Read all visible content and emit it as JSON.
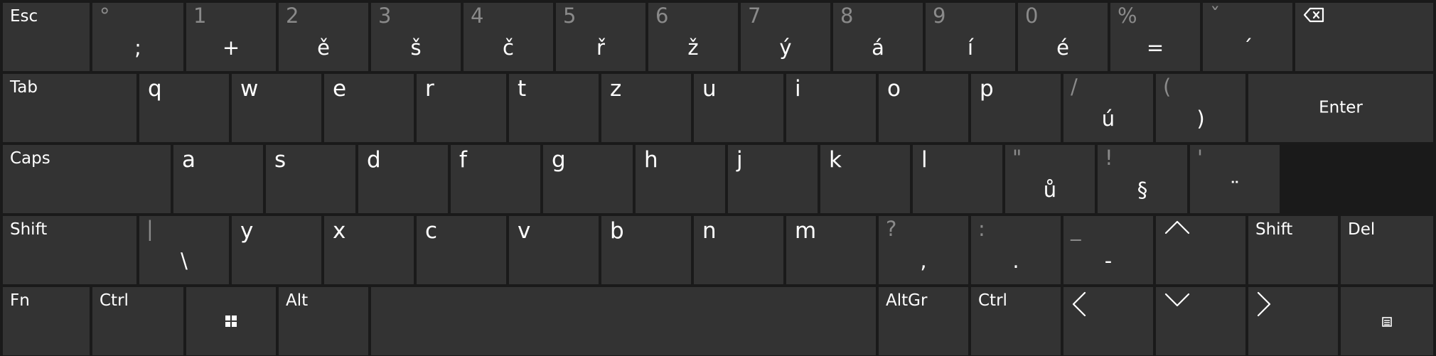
{
  "keyboard": {
    "row1": [
      {
        "label": "Esc"
      },
      {
        "top": "°",
        "main": ";"
      },
      {
        "top": "1",
        "main": "+"
      },
      {
        "top": "2",
        "main": "ě"
      },
      {
        "top": "3",
        "main": "š"
      },
      {
        "top": "4",
        "main": "č"
      },
      {
        "top": "5",
        "main": "ř"
      },
      {
        "top": "6",
        "main": "ž"
      },
      {
        "top": "7",
        "main": "ý"
      },
      {
        "top": "8",
        "main": "á"
      },
      {
        "top": "9",
        "main": "í"
      },
      {
        "top": "0",
        "main": "é"
      },
      {
        "top": "%",
        "main": "="
      },
      {
        "top": "ˇ",
        "main": "´"
      },
      {
        "icon": "backspace-icon"
      }
    ],
    "row2": [
      {
        "label": "Tab"
      },
      {
        "letter": "q"
      },
      {
        "letter": "w"
      },
      {
        "letter": "e"
      },
      {
        "letter": "r"
      },
      {
        "letter": "t"
      },
      {
        "letter": "z"
      },
      {
        "letter": "u"
      },
      {
        "letter": "i"
      },
      {
        "letter": "o"
      },
      {
        "letter": "p"
      },
      {
        "top": "/",
        "main": "ú"
      },
      {
        "top": "(",
        "main": ")"
      },
      {
        "center": "Enter"
      }
    ],
    "row3": [
      {
        "label": "Caps"
      },
      {
        "letter": "a"
      },
      {
        "letter": "s"
      },
      {
        "letter": "d"
      },
      {
        "letter": "f"
      },
      {
        "letter": "g"
      },
      {
        "letter": "h"
      },
      {
        "letter": "j"
      },
      {
        "letter": "k"
      },
      {
        "letter": "l"
      },
      {
        "top": "\"",
        "main": "ů"
      },
      {
        "top": "!",
        "main": "§"
      },
      {
        "top": "'",
        "main": "¨"
      }
    ],
    "row4": [
      {
        "label": "Shift"
      },
      {
        "top": "|",
        "main": "\\"
      },
      {
        "letter": "y"
      },
      {
        "letter": "x"
      },
      {
        "letter": "c"
      },
      {
        "letter": "v"
      },
      {
        "letter": "b"
      },
      {
        "letter": "n"
      },
      {
        "letter": "m"
      },
      {
        "top": "?",
        "main": ","
      },
      {
        "top": ":",
        "main": "."
      },
      {
        "top": "_",
        "main": "-"
      },
      {
        "icon": "arrow-up-icon"
      },
      {
        "label": "Shift"
      },
      {
        "label": "Del"
      }
    ],
    "row5": [
      {
        "label": "Fn"
      },
      {
        "label": "Ctrl"
      },
      {
        "icon": "windows-icon"
      },
      {
        "label": "Alt"
      },
      {
        "space": ""
      },
      {
        "label": "AltGr"
      },
      {
        "label": "Ctrl"
      },
      {
        "icon": "arrow-left-icon"
      },
      {
        "icon": "arrow-down-icon"
      },
      {
        "icon": "arrow-right-icon"
      },
      {
        "icon": "keyboard-menu-icon"
      }
    ]
  }
}
